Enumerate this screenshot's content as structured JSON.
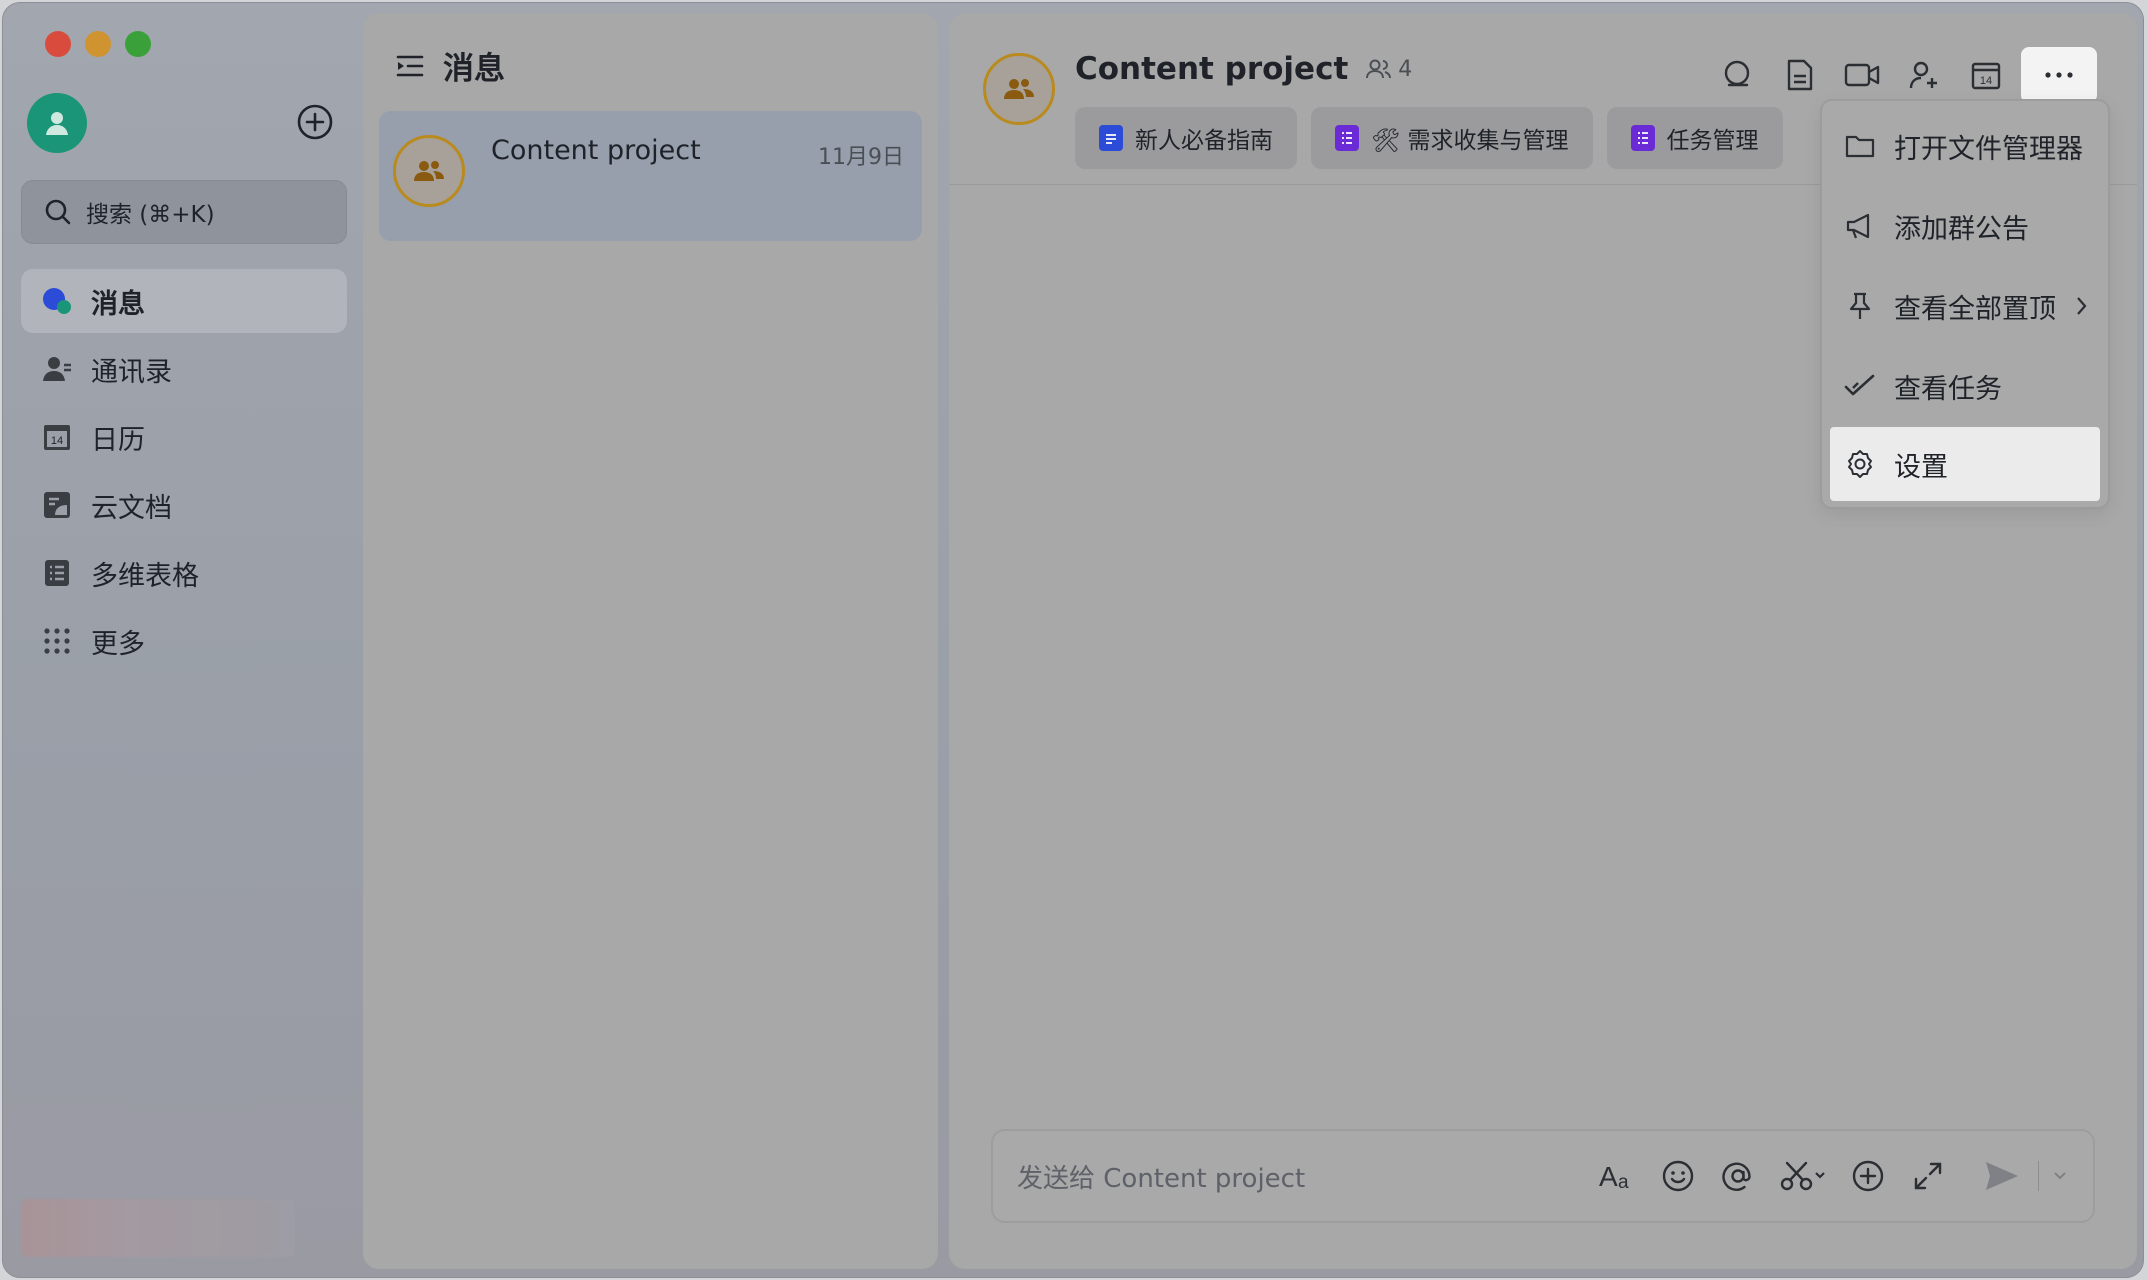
{
  "sidebar": {
    "search_label": "搜索 (⌘+K)",
    "items": [
      {
        "label": "消息",
        "icon": "messages-icon"
      },
      {
        "label": "通讯录",
        "icon": "contacts-icon"
      },
      {
        "label": "日历",
        "icon": "calendar-icon",
        "badge": "14"
      },
      {
        "label": "云文档",
        "icon": "docs-icon"
      },
      {
        "label": "多维表格",
        "icon": "base-icon"
      },
      {
        "label": "更多",
        "icon": "more-grid-icon"
      }
    ]
  },
  "list": {
    "title": "消息",
    "chats": [
      {
        "name": "Content project",
        "time": "11月9日"
      }
    ]
  },
  "chat": {
    "title": "Content project",
    "member_count": "4",
    "tabs": [
      {
        "label": "新人必备指南",
        "color": "#2c4bd6"
      },
      {
        "label": "🛠 需求收集与管理",
        "color": "#6a2bd6"
      },
      {
        "label": "任务管理",
        "color": "#6a2bd6"
      }
    ],
    "calendar_badge": "14",
    "composer_placeholder": "发送给 Content project"
  },
  "menu": {
    "items": [
      {
        "label": "打开文件管理器",
        "icon": "folder-icon"
      },
      {
        "label": "添加群公告",
        "icon": "megaphone-icon"
      },
      {
        "label": "查看全部置顶",
        "icon": "pin-icon",
        "has_submenu": true
      },
      {
        "label": "查看任务",
        "icon": "task-check-icon"
      },
      {
        "label": "设置",
        "icon": "gear-icon",
        "highlighted": true
      }
    ]
  },
  "colors": {
    "accent_avatar": "#1a9577",
    "group_avatar_ring": "#b98a1e",
    "doc_blue": "#2c4bd6",
    "base_purple": "#6a2bd6"
  }
}
